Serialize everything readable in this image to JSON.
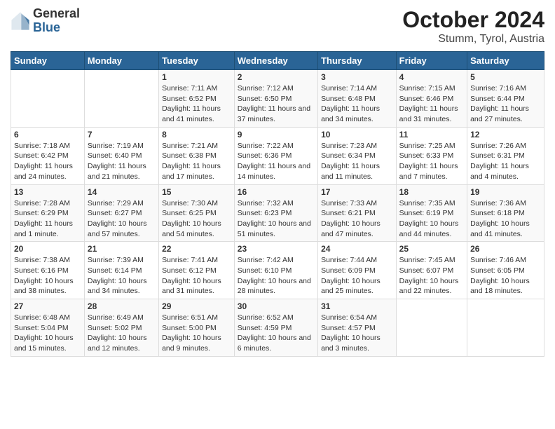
{
  "header": {
    "logo_general": "General",
    "logo_blue": "Blue",
    "title": "October 2024",
    "location": "Stumm, Tyrol, Austria"
  },
  "weekdays": [
    "Sunday",
    "Monday",
    "Tuesday",
    "Wednesday",
    "Thursday",
    "Friday",
    "Saturday"
  ],
  "weeks": [
    [
      {
        "day": "",
        "info": ""
      },
      {
        "day": "",
        "info": ""
      },
      {
        "day": "1",
        "info": "Sunrise: 7:11 AM\nSunset: 6:52 PM\nDaylight: 11 hours and 41 minutes."
      },
      {
        "day": "2",
        "info": "Sunrise: 7:12 AM\nSunset: 6:50 PM\nDaylight: 11 hours and 37 minutes."
      },
      {
        "day": "3",
        "info": "Sunrise: 7:14 AM\nSunset: 6:48 PM\nDaylight: 11 hours and 34 minutes."
      },
      {
        "day": "4",
        "info": "Sunrise: 7:15 AM\nSunset: 6:46 PM\nDaylight: 11 hours and 31 minutes."
      },
      {
        "day": "5",
        "info": "Sunrise: 7:16 AM\nSunset: 6:44 PM\nDaylight: 11 hours and 27 minutes."
      }
    ],
    [
      {
        "day": "6",
        "info": "Sunrise: 7:18 AM\nSunset: 6:42 PM\nDaylight: 11 hours and 24 minutes."
      },
      {
        "day": "7",
        "info": "Sunrise: 7:19 AM\nSunset: 6:40 PM\nDaylight: 11 hours and 21 minutes."
      },
      {
        "day": "8",
        "info": "Sunrise: 7:21 AM\nSunset: 6:38 PM\nDaylight: 11 hours and 17 minutes."
      },
      {
        "day": "9",
        "info": "Sunrise: 7:22 AM\nSunset: 6:36 PM\nDaylight: 11 hours and 14 minutes."
      },
      {
        "day": "10",
        "info": "Sunrise: 7:23 AM\nSunset: 6:34 PM\nDaylight: 11 hours and 11 minutes."
      },
      {
        "day": "11",
        "info": "Sunrise: 7:25 AM\nSunset: 6:33 PM\nDaylight: 11 hours and 7 minutes."
      },
      {
        "day": "12",
        "info": "Sunrise: 7:26 AM\nSunset: 6:31 PM\nDaylight: 11 hours and 4 minutes."
      }
    ],
    [
      {
        "day": "13",
        "info": "Sunrise: 7:28 AM\nSunset: 6:29 PM\nDaylight: 11 hours and 1 minute."
      },
      {
        "day": "14",
        "info": "Sunrise: 7:29 AM\nSunset: 6:27 PM\nDaylight: 10 hours and 57 minutes."
      },
      {
        "day": "15",
        "info": "Sunrise: 7:30 AM\nSunset: 6:25 PM\nDaylight: 10 hours and 54 minutes."
      },
      {
        "day": "16",
        "info": "Sunrise: 7:32 AM\nSunset: 6:23 PM\nDaylight: 10 hours and 51 minutes."
      },
      {
        "day": "17",
        "info": "Sunrise: 7:33 AM\nSunset: 6:21 PM\nDaylight: 10 hours and 47 minutes."
      },
      {
        "day": "18",
        "info": "Sunrise: 7:35 AM\nSunset: 6:19 PM\nDaylight: 10 hours and 44 minutes."
      },
      {
        "day": "19",
        "info": "Sunrise: 7:36 AM\nSunset: 6:18 PM\nDaylight: 10 hours and 41 minutes."
      }
    ],
    [
      {
        "day": "20",
        "info": "Sunrise: 7:38 AM\nSunset: 6:16 PM\nDaylight: 10 hours and 38 minutes."
      },
      {
        "day": "21",
        "info": "Sunrise: 7:39 AM\nSunset: 6:14 PM\nDaylight: 10 hours and 34 minutes."
      },
      {
        "day": "22",
        "info": "Sunrise: 7:41 AM\nSunset: 6:12 PM\nDaylight: 10 hours and 31 minutes."
      },
      {
        "day": "23",
        "info": "Sunrise: 7:42 AM\nSunset: 6:10 PM\nDaylight: 10 hours and 28 minutes."
      },
      {
        "day": "24",
        "info": "Sunrise: 7:44 AM\nSunset: 6:09 PM\nDaylight: 10 hours and 25 minutes."
      },
      {
        "day": "25",
        "info": "Sunrise: 7:45 AM\nSunset: 6:07 PM\nDaylight: 10 hours and 22 minutes."
      },
      {
        "day": "26",
        "info": "Sunrise: 7:46 AM\nSunset: 6:05 PM\nDaylight: 10 hours and 18 minutes."
      }
    ],
    [
      {
        "day": "27",
        "info": "Sunrise: 6:48 AM\nSunset: 5:04 PM\nDaylight: 10 hours and 15 minutes."
      },
      {
        "day": "28",
        "info": "Sunrise: 6:49 AM\nSunset: 5:02 PM\nDaylight: 10 hours and 12 minutes."
      },
      {
        "day": "29",
        "info": "Sunrise: 6:51 AM\nSunset: 5:00 PM\nDaylight: 10 hours and 9 minutes."
      },
      {
        "day": "30",
        "info": "Sunrise: 6:52 AM\nSunset: 4:59 PM\nDaylight: 10 hours and 6 minutes."
      },
      {
        "day": "31",
        "info": "Sunrise: 6:54 AM\nSunset: 4:57 PM\nDaylight: 10 hours and 3 minutes."
      },
      {
        "day": "",
        "info": ""
      },
      {
        "day": "",
        "info": ""
      }
    ]
  ]
}
